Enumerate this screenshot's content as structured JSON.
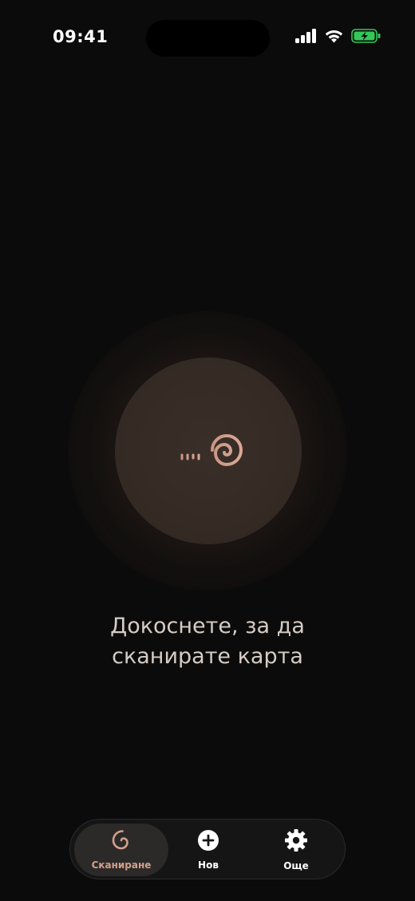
{
  "status_bar": {
    "time": "09:41"
  },
  "main": {
    "prompt_line1": "Докоснете, за да",
    "prompt_line2": "сканирате карта"
  },
  "tab_bar": {
    "tabs": [
      {
        "label": "Сканиране",
        "icon": "spiral-icon",
        "active": true
      },
      {
        "label": "Нов",
        "icon": "plus-circle-icon",
        "active": false
      },
      {
        "label": "Още",
        "icon": "gear-icon",
        "active": false
      }
    ]
  },
  "colors": {
    "accent": "#d2a08c",
    "background": "#0b0b0b",
    "battery_green": "#34c759"
  }
}
